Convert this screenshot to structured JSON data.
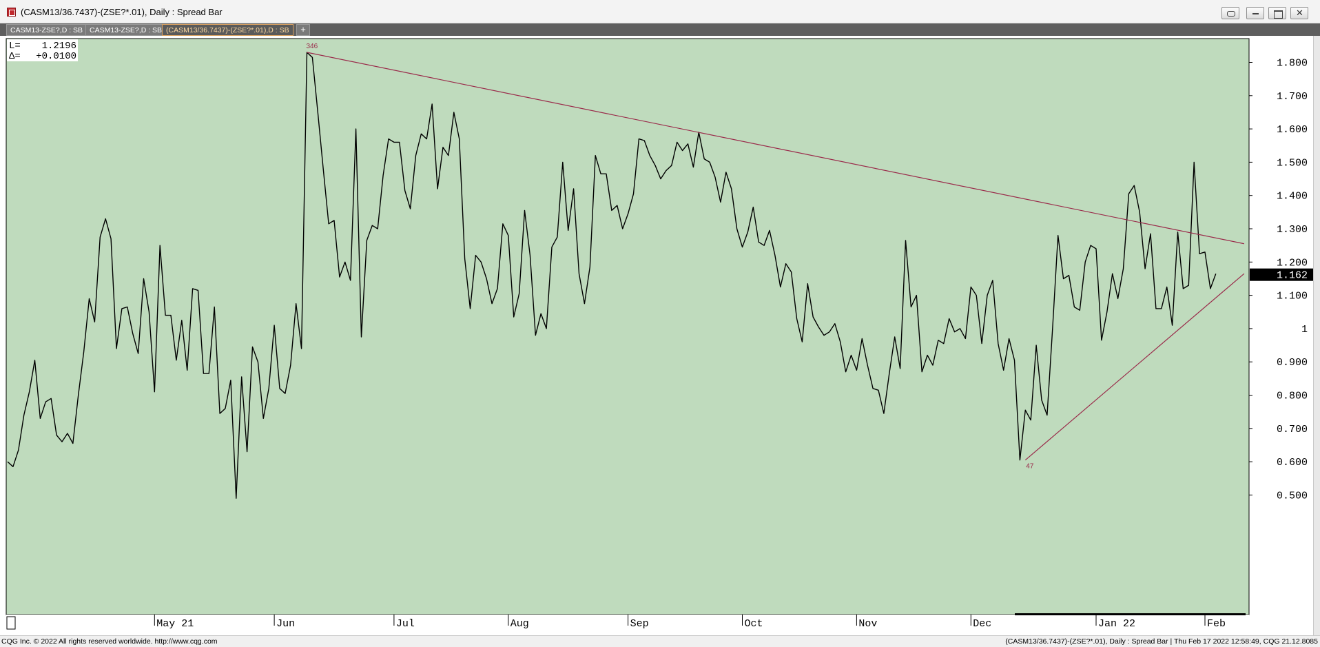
{
  "window": {
    "title": "(CASM13/36.7437)-(ZSE?*.01), Daily : Spread Bar"
  },
  "tabs": [
    {
      "label": "CASM13-ZSE?,D : SB",
      "active": false
    },
    {
      "label": "CASM13-ZSE?,D : SB",
      "active": false
    },
    {
      "label": "(CASM13/36.7437)-(ZSE?*.01),D : SB",
      "active": true
    }
  ],
  "tab_add_label": "+",
  "readout": {
    "last_label": "L=",
    "last_value": "1.2196",
    "delta_label": "Δ=",
    "delta_value": "+0.0100"
  },
  "colors": {
    "plot_bg": "#bfdbbd",
    "series_line": "#000000",
    "trendline": "#9a2a4a",
    "price_marker_bg": "#000000"
  },
  "status": {
    "left": "CQG Inc. © 2022 All rights reserved worldwide. http://www.cqg.com",
    "right": "(CASM13/36.7437)-(ZSE?*.01), Daily : Spread Bar | Thu Feb 17 2022 12:58:49, CQG 21.12.8085"
  },
  "chart_data": {
    "type": "line",
    "title": "",
    "xlabel": "",
    "ylabel": "",
    "ylim": [
      0.48,
      1.83
    ],
    "y_ticks": [
      {
        "value": 1.8,
        "label": "1.800"
      },
      {
        "value": 1.7,
        "label": "1.700"
      },
      {
        "value": 1.6,
        "label": "1.600"
      },
      {
        "value": 1.5,
        "label": "1.500"
      },
      {
        "value": 1.4,
        "label": "1.400"
      },
      {
        "value": 1.3,
        "label": "1.300"
      },
      {
        "value": 1.2,
        "label": "1.200"
      },
      {
        "value": 1.1,
        "label": "1.100"
      },
      {
        "value": 1.0,
        "label": "1"
      },
      {
        "value": 0.9,
        "label": "0.900"
      },
      {
        "value": 0.8,
        "label": "0.800"
      },
      {
        "value": 0.7,
        "label": "0.700"
      },
      {
        "value": 0.6,
        "label": "0.600"
      },
      {
        "value": 0.5,
        "label": "0.500"
      }
    ],
    "x_ticks": [
      {
        "index": 27,
        "label": "May 21"
      },
      {
        "index": 49,
        "label": "Jun"
      },
      {
        "index": 71,
        "label": "Jul"
      },
      {
        "index": 92,
        "label": "Aug"
      },
      {
        "index": 114,
        "label": "Sep"
      },
      {
        "index": 135,
        "label": "Oct"
      },
      {
        "index": 156,
        "label": "Nov"
      },
      {
        "index": 177,
        "label": "Dec"
      },
      {
        "index": 200,
        "label": "Jan 22"
      },
      {
        "index": 220,
        "label": "Feb"
      }
    ],
    "current_price": {
      "value": 1.162,
      "label": "1.162"
    },
    "high_marker": {
      "index": 55,
      "value": 1.83,
      "label": "346"
    },
    "low_marker": {
      "index": 187,
      "value": 0.605,
      "label": "47"
    },
    "trendlines": [
      {
        "from": {
          "index": 55,
          "value": 1.83
        },
        "to": {
          "index": 227.2,
          "value": 1.255
        }
      },
      {
        "from": {
          "index": 187,
          "value": 0.605
        },
        "to": {
          "index": 227.2,
          "value": 1.165
        }
      }
    ],
    "series": [
      {
        "x_start": 0,
        "values": [
          0.6,
          0.585,
          0.635,
          0.74,
          0.81,
          0.905,
          0.73,
          0.78,
          0.79,
          0.68,
          0.66,
          0.685,
          0.655,
          0.8,
          0.93,
          1.09,
          1.02,
          1.275,
          1.33,
          1.27,
          0.94,
          1.06,
          1.065,
          0.985,
          0.925,
          1.15,
          1.05,
          0.81,
          1.25,
          1.04,
          1.04,
          0.905,
          1.025,
          0.875,
          1.12,
          1.115,
          0.865,
          0.865,
          1.065,
          0.745,
          0.76,
          0.845,
          0.49,
          0.855,
          0.63,
          0.945,
          0.9,
          0.73,
          0.82,
          1.01,
          0.82,
          0.805,
          0.89,
          1.075,
          0.94,
          1.83,
          1.815,
          1.65,
          1.48,
          1.315,
          1.325,
          1.155,
          1.2,
          1.145,
          1.6,
          0.975,
          1.265,
          1.31,
          1.3,
          1.46,
          1.57,
          1.56,
          1.56,
          1.415,
          1.36,
          1.52,
          1.585,
          1.57,
          1.675,
          1.42,
          1.545,
          1.52,
          1.65,
          1.57,
          1.21,
          1.06,
          1.22,
          1.2,
          1.15,
          1.075,
          1.12,
          1.315,
          1.28,
          1.035,
          1.105,
          1.355,
          1.22,
          0.98,
          1.045,
          1.0,
          1.245,
          1.275,
          1.5,
          1.295,
          1.42,
          1.165,
          1.075,
          1.185,
          1.52,
          1.465,
          1.465,
          1.355,
          1.37,
          1.3,
          1.345,
          1.405,
          1.57,
          1.565,
          1.52,
          1.49,
          1.45,
          1.475,
          1.49,
          1.56,
          1.535,
          1.555,
          1.485,
          1.59,
          1.51,
          1.5,
          1.455,
          1.38,
          1.47,
          1.42,
          1.3,
          1.245,
          1.29,
          1.365,
          1.26,
          1.25,
          1.295,
          1.22,
          1.125,
          1.195,
          1.17,
          1.03,
          0.96,
          1.135,
          1.035,
          1.005,
          0.98,
          0.99,
          1.015,
          0.96,
          0.87,
          0.92,
          0.875,
          0.97,
          0.89,
          0.82,
          0.815,
          0.745,
          0.865,
          0.975,
          0.88,
          1.265,
          1.065,
          1.1,
          0.87,
          0.92,
          0.89,
          0.965,
          0.955,
          1.03,
          0.99,
          1.0,
          0.97,
          1.125,
          1.1,
          0.955,
          1.1,
          1.145,
          0.955,
          0.875,
          0.97,
          0.905,
          0.605,
          0.755,
          0.725,
          0.95,
          0.785,
          0.74,
          1.0,
          1.28,
          1.15,
          1.16,
          1.065,
          1.055,
          1.2,
          1.25,
          1.24,
          0.965,
          1.05,
          1.165,
          1.09,
          1.18,
          1.405,
          1.43,
          1.35,
          1.18,
          1.285,
          1.06,
          1.06,
          1.125,
          1.01,
          1.29,
          1.12,
          1.13,
          1.5,
          1.225,
          1.23,
          1.12,
          1.165
        ]
      }
    ]
  }
}
